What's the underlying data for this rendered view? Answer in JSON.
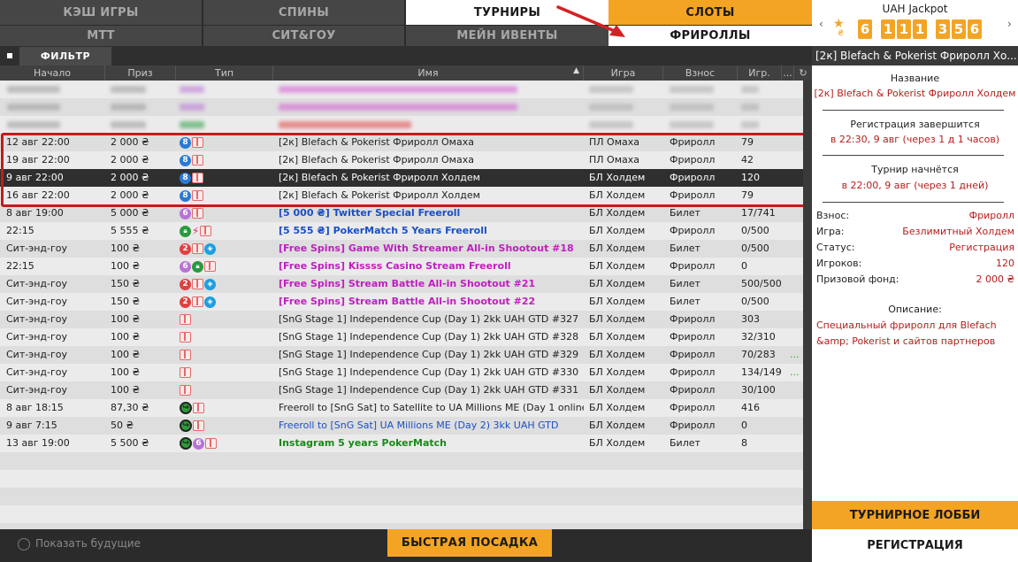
{
  "tabs_top": [
    {
      "label": "КЭШ ИГРЫ",
      "state": "dark"
    },
    {
      "label": "СПИНЫ",
      "state": "dark"
    },
    {
      "label": "ТУРНИРЫ",
      "state": "light"
    },
    {
      "label": "СЛОТЫ",
      "state": "orange"
    }
  ],
  "tabs_sub": [
    {
      "label": "МТТ",
      "state": "dark"
    },
    {
      "label": "СИТ&ГОУ",
      "state": "dark"
    },
    {
      "label": "МЕЙН ИВЕНТЫ",
      "state": "dark"
    },
    {
      "label": "ФРИРОЛЛЫ",
      "state": "light"
    }
  ],
  "filter": {
    "label": "ФИЛЬТР"
  },
  "columns": [
    "Начало",
    "Приз",
    "Тип",
    "Имя",
    "Игра",
    "Взнос",
    "Игр.",
    "..."
  ],
  "blurred_rows": [
    {
      "name_color": "pink"
    },
    {
      "name_color": "pink"
    },
    {
      "name_color": "dark"
    }
  ],
  "rows": [
    {
      "start": "12 авг 22:00",
      "prize": "2 000 ₴",
      "icons": [
        "n8",
        "gift"
      ],
      "name": "[2к] Blefach & Pokerist Фриролл Омаха",
      "color": "dark",
      "game": "ПЛ Омаха",
      "fee": "Фриролл",
      "players": "79",
      "more": ""
    },
    {
      "start": "19 авг 22:00",
      "prize": "2 000 ₴",
      "icons": [
        "n8",
        "gift"
      ],
      "name": "[2к] Blefach & Pokerist Фриролл Омаха",
      "color": "dark",
      "game": "ПЛ Омаха",
      "fee": "Фриролл",
      "players": "42",
      "more": ""
    },
    {
      "start": "9 авг 22:00",
      "prize": "2 000 ₴",
      "icons": [
        "n8",
        "gift"
      ],
      "name": "[2к] Blefach & Pokerist Фриролл Холдем",
      "color": "dark",
      "game": "БЛ Холдем",
      "fee": "Фриролл",
      "players": "120",
      "more": "",
      "selected": true
    },
    {
      "start": "16 авг 22:00",
      "prize": "2 000 ₴",
      "icons": [
        "n8",
        "gift"
      ],
      "name": "[2к] Blefach & Pokerist Фриролл Холдем",
      "color": "dark",
      "game": "БЛ Холдем",
      "fee": "Фриролл",
      "players": "79",
      "more": ""
    },
    {
      "start": "8 авг 19:00",
      "prize": "5 000 ₴",
      "icons": [
        "p6",
        "gift"
      ],
      "name": "[5 000 ₴] Twitter Special Freeroll",
      "color": "blue",
      "game": "БЛ Холдем",
      "fee": "Билет",
      "players": "17/741",
      "more": ""
    },
    {
      "start": "22:15",
      "prize": "5 555 ₴",
      "icons": [
        "lock",
        "bolt",
        "gift"
      ],
      "name": "[5 555 ₴] PokerMatch 5 Years Freeroll",
      "color": "blue",
      "game": "БЛ Холдем",
      "fee": "Фриролл",
      "players": "0/500",
      "more": ""
    },
    {
      "start": "Сит-энд-гоу",
      "prize": "100 ₴",
      "icons": [
        "r2",
        "gift",
        "spin"
      ],
      "name": "[Free Spins] Game With Streamer All-in Shootout #18",
      "color": "pink",
      "game": "БЛ Холдем",
      "fee": "Билет",
      "players": "0/500",
      "more": ""
    },
    {
      "start": "22:15",
      "prize": "100 ₴",
      "icons": [
        "p6",
        "lock",
        "gift"
      ],
      "name": "[Free Spins] Kissss Casino Stream Freeroll",
      "color": "pink",
      "game": "БЛ Холдем",
      "fee": "Фриролл",
      "players": "0",
      "more": ""
    },
    {
      "start": "Сит-энд-гоу",
      "prize": "150 ₴",
      "icons": [
        "r2",
        "gift",
        "spin"
      ],
      "name": "[Free Spins] Stream Battle All-in Shootout #21",
      "color": "pink",
      "game": "БЛ Холдем",
      "fee": "Билет",
      "players": "500/500",
      "more": ""
    },
    {
      "start": "Сит-энд-гоу",
      "prize": "150 ₴",
      "icons": [
        "r2",
        "gift",
        "spin"
      ],
      "name": "[Free Spins] Stream Battle All-in Shootout #22",
      "color": "pink",
      "game": "БЛ Холдем",
      "fee": "Билет",
      "players": "0/500",
      "more": ""
    },
    {
      "start": "Сит-энд-гоу",
      "prize": "100 ₴",
      "icons": [
        "gift"
      ],
      "name": "[SnG Stage 1] Independence Cup (Day 1) 2kk UAH GTD #327",
      "color": "dark",
      "game": "БЛ Холдем",
      "fee": "Фриролл",
      "players": "303",
      "more": ""
    },
    {
      "start": "Сит-энд-гоу",
      "prize": "100 ₴",
      "icons": [
        "gift"
      ],
      "name": "[SnG Stage 1] Independence Cup (Day 1) 2kk UAH GTD #328",
      "color": "dark",
      "game": "БЛ Холдем",
      "fee": "Фриролл",
      "players": "32/310",
      "more": ""
    },
    {
      "start": "Сит-энд-гоу",
      "prize": "100 ₴",
      "icons": [
        "gift"
      ],
      "name": "[SnG Stage 1] Independence Cup (Day 1) 2kk UAH GTD #329",
      "color": "dark",
      "game": "БЛ Холдем",
      "fee": "Фриролл",
      "players": "70/283",
      "more": "..."
    },
    {
      "start": "Сит-энд-гоу",
      "prize": "100 ₴",
      "icons": [
        "gift"
      ],
      "name": "[SnG Stage 1] Independence Cup (Day 1) 2kk UAH GTD #330",
      "color": "dark",
      "game": "БЛ Холдем",
      "fee": "Фриролл",
      "players": "134/149",
      "more": "..."
    },
    {
      "start": "Сит-энд-гоу",
      "prize": "100 ₴",
      "icons": [
        "gift"
      ],
      "name": "[SnG Stage 1] Independence Cup (Day 1) 2kk UAH GTD #331",
      "color": "dark",
      "game": "БЛ Холдем",
      "fee": "Фриролл",
      "players": "30/100",
      "more": ""
    },
    {
      "start": "8 авг 18:15",
      "prize": "87,30 ₴",
      "icons": [
        "sat",
        "gift"
      ],
      "name": "Freeroll to [SnG Sat] to Satellite to UA Millions ME (Day 1 online...",
      "color": "dark",
      "game": "БЛ Холдем",
      "fee": "Фриролл",
      "players": "416",
      "more": ""
    },
    {
      "start": "9 авг 7:15",
      "prize": "50 ₴",
      "icons": [
        "sat",
        "gift"
      ],
      "name": "Freeroll to [SnG Sat] UA Millions ME (Day 2) 3kk UAH GTD",
      "color": "blue",
      "game": "БЛ Холдем",
      "fee": "Фриролл",
      "players": "0",
      "more": ""
    },
    {
      "start": "13 авг 19:00",
      "prize": "5 500 ₴",
      "icons": [
        "sat",
        "p6",
        "gift"
      ],
      "name": "Instagram 5 years PokerMatch",
      "color": "green",
      "game": "БЛ Холдем",
      "fee": "Билет",
      "players": "8",
      "more": ""
    }
  ],
  "bottom": {
    "future_label": "Показать будущие",
    "quick_seat": "БЫСТРАЯ ПОСАДКА"
  },
  "jackpot": {
    "title": "UAH Jackpot",
    "currency": "₴",
    "digits": [
      "6",
      "1",
      "1",
      "1",
      "3",
      "5",
      "6"
    ],
    "prev": "‹",
    "next": "›"
  },
  "details": {
    "header": "[2к] Blefach & Pokerist Фриролл Хо...",
    "name_label": "Название",
    "name_value": "[2к] Blefach & Pokerist Фриролл Холдем",
    "reg_label": "Регистрация завершится",
    "reg_value": "в 22:30, 9 авг (через 1 д 1 часов)",
    "start_label": "Турнир начнётся",
    "start_value": "в 22:00, 9 авг (через 1 дней)",
    "kv": [
      {
        "k": "Взнос:",
        "v": "Фриролл"
      },
      {
        "k": "Игра:",
        "v": "Безлимитный Холдем"
      },
      {
        "k": "Статус:",
        "v": "Регистрация"
      },
      {
        "k": "Игроков:",
        "v": "120"
      },
      {
        "k": "Призовой фонд:",
        "v": "2 000 ₴"
      }
    ],
    "desc_label": "Описание:",
    "desc_value": "Специальный фриролл для Blefach &amp; Pokerist и сайтов партнеров"
  },
  "actions": {
    "lobby": "ТУРНИРНОЕ ЛОББИ",
    "register": "РЕГИСТРАЦИЯ"
  },
  "colors": {
    "accent": "#f4a423",
    "highlight": "#c51b1b",
    "value_red": "#b71c1c"
  }
}
